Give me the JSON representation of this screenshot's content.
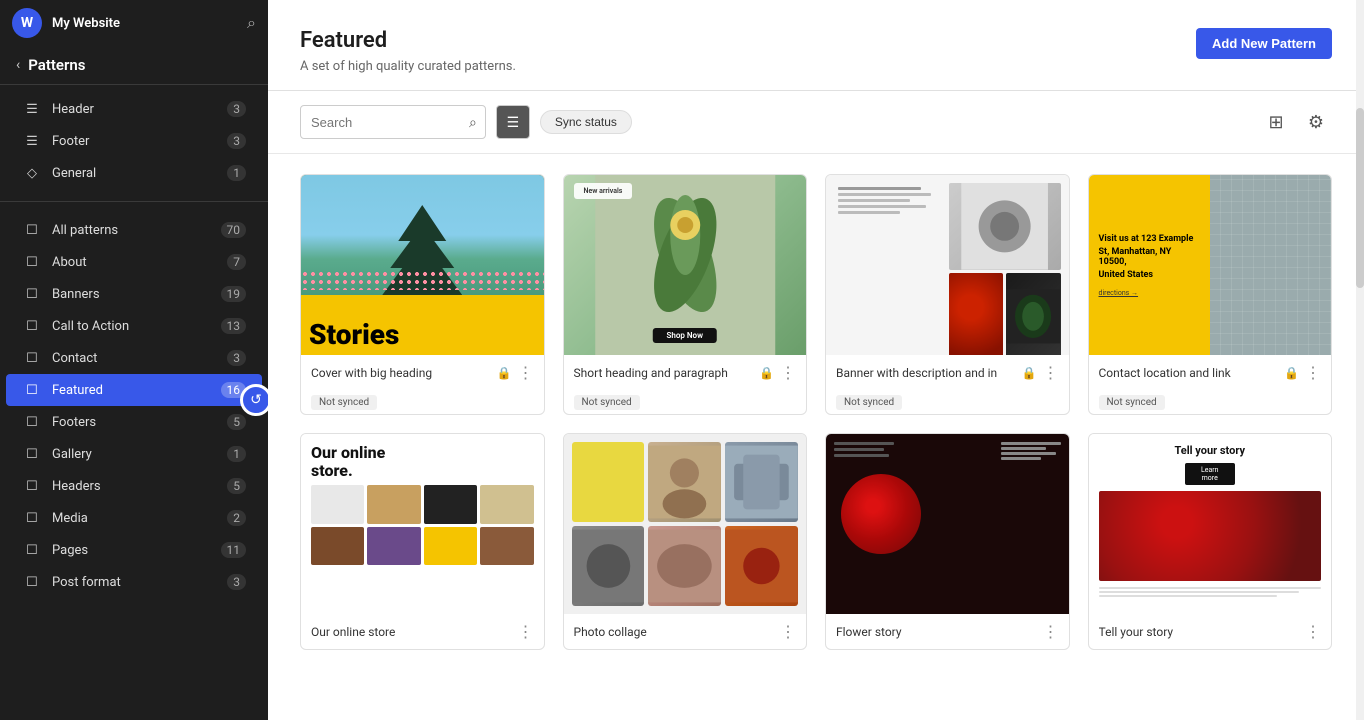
{
  "app": {
    "logo": "W",
    "site_title": "My Website",
    "search_icon": "⌕"
  },
  "sidebar": {
    "back_label": "‹",
    "title": "Patterns",
    "nav_top": [
      {
        "id": "header",
        "label": "Header",
        "count": "3",
        "icon": "☰",
        "active": false
      },
      {
        "id": "footer",
        "label": "Footer",
        "count": "3",
        "icon": "☰",
        "active": false
      },
      {
        "id": "general",
        "label": "General",
        "count": "1",
        "icon": "◇",
        "active": false
      }
    ],
    "nav_patterns": [
      {
        "id": "all-patterns",
        "label": "All patterns",
        "count": "70",
        "icon": "☐",
        "active": false
      },
      {
        "id": "about",
        "label": "About",
        "count": "7",
        "icon": "☐",
        "active": false
      },
      {
        "id": "banners",
        "label": "Banners",
        "count": "19",
        "icon": "☐",
        "active": false
      },
      {
        "id": "call-to-action",
        "label": "Call to Action",
        "count": "13",
        "icon": "☐",
        "active": false
      },
      {
        "id": "contact",
        "label": "Contact",
        "count": "3",
        "icon": "☐",
        "active": false
      },
      {
        "id": "featured",
        "label": "Featured",
        "count": "16",
        "icon": "☐",
        "active": true
      },
      {
        "id": "footers",
        "label": "Footers",
        "count": "5",
        "icon": "☐",
        "active": false
      },
      {
        "id": "gallery",
        "label": "Gallery",
        "count": "1",
        "icon": "☐",
        "active": false
      },
      {
        "id": "headers",
        "label": "Headers",
        "count": "5",
        "icon": "☐",
        "active": false
      },
      {
        "id": "media",
        "label": "Media",
        "count": "2",
        "icon": "☐",
        "active": false
      },
      {
        "id": "pages",
        "label": "Pages",
        "count": "11",
        "icon": "☐",
        "active": false
      },
      {
        "id": "post-format",
        "label": "Post format",
        "count": "3",
        "icon": "☐",
        "active": false
      }
    ]
  },
  "main": {
    "title": "Featured",
    "subtitle": "A set of high quality curated patterns.",
    "add_new_label": "Add New Pattern",
    "search_placeholder": "Search",
    "sync_status_label": "Sync status",
    "patterns": [
      {
        "id": "cover-big-heading",
        "name": "Cover with big heading",
        "badge": "Not synced",
        "type": "stories"
      },
      {
        "id": "short-heading-paragraph",
        "name": "Short heading and paragraph",
        "badge": "Not synced",
        "type": "plant"
      },
      {
        "id": "banner-description",
        "name": "Banner with description and in",
        "badge": "Not synced",
        "type": "banner"
      },
      {
        "id": "contact-location-link",
        "name": "Contact location and link",
        "badge": "Not synced",
        "type": "contact"
      },
      {
        "id": "online-store",
        "name": "Our online store",
        "badge": "",
        "type": "store"
      },
      {
        "id": "collage2",
        "name": "Photo collage",
        "badge": "",
        "type": "collage2"
      },
      {
        "id": "flower-story",
        "name": "Flower story",
        "badge": "",
        "type": "flower-story"
      },
      {
        "id": "tell-story",
        "name": "Tell your story",
        "badge": "",
        "type": "tell"
      }
    ]
  }
}
